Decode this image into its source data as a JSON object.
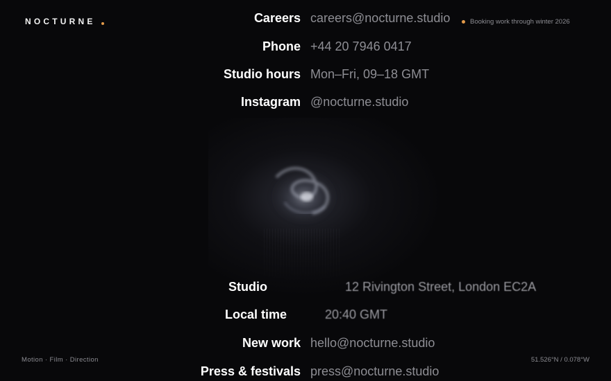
{
  "brand": {
    "name": "NOCTURNE",
    "accent_color": "#e39a4a"
  },
  "status": {
    "text": "Booking work through winter 2026"
  },
  "contacts_top": [
    {
      "label": "Careers",
      "value": "careers@nocturne.studio"
    },
    {
      "label": "Phone",
      "value": "+44 20 7946 0417"
    },
    {
      "label": "Studio hours",
      "value": "Mon–Fri, 09–18 GMT"
    },
    {
      "label": "Instagram",
      "value": "@nocturne.studio"
    }
  ],
  "contacts_bottom": [
    {
      "label": "Studio",
      "value": "12 Rivington Street, London EC2A"
    },
    {
      "label": "Local time",
      "value": "20:40 GMT"
    },
    {
      "label": "New work",
      "value": "hello@nocturne.studio"
    },
    {
      "label": "Press & festivals",
      "value": "press@nocturne.studio"
    }
  ],
  "footer": {
    "disciplines": "Motion · Film · Direction",
    "coordinates": "51.526°N / 0.078°W"
  },
  "colors": {
    "background": "#08080a",
    "label": "#ffffff",
    "value": "#8e8e94"
  }
}
